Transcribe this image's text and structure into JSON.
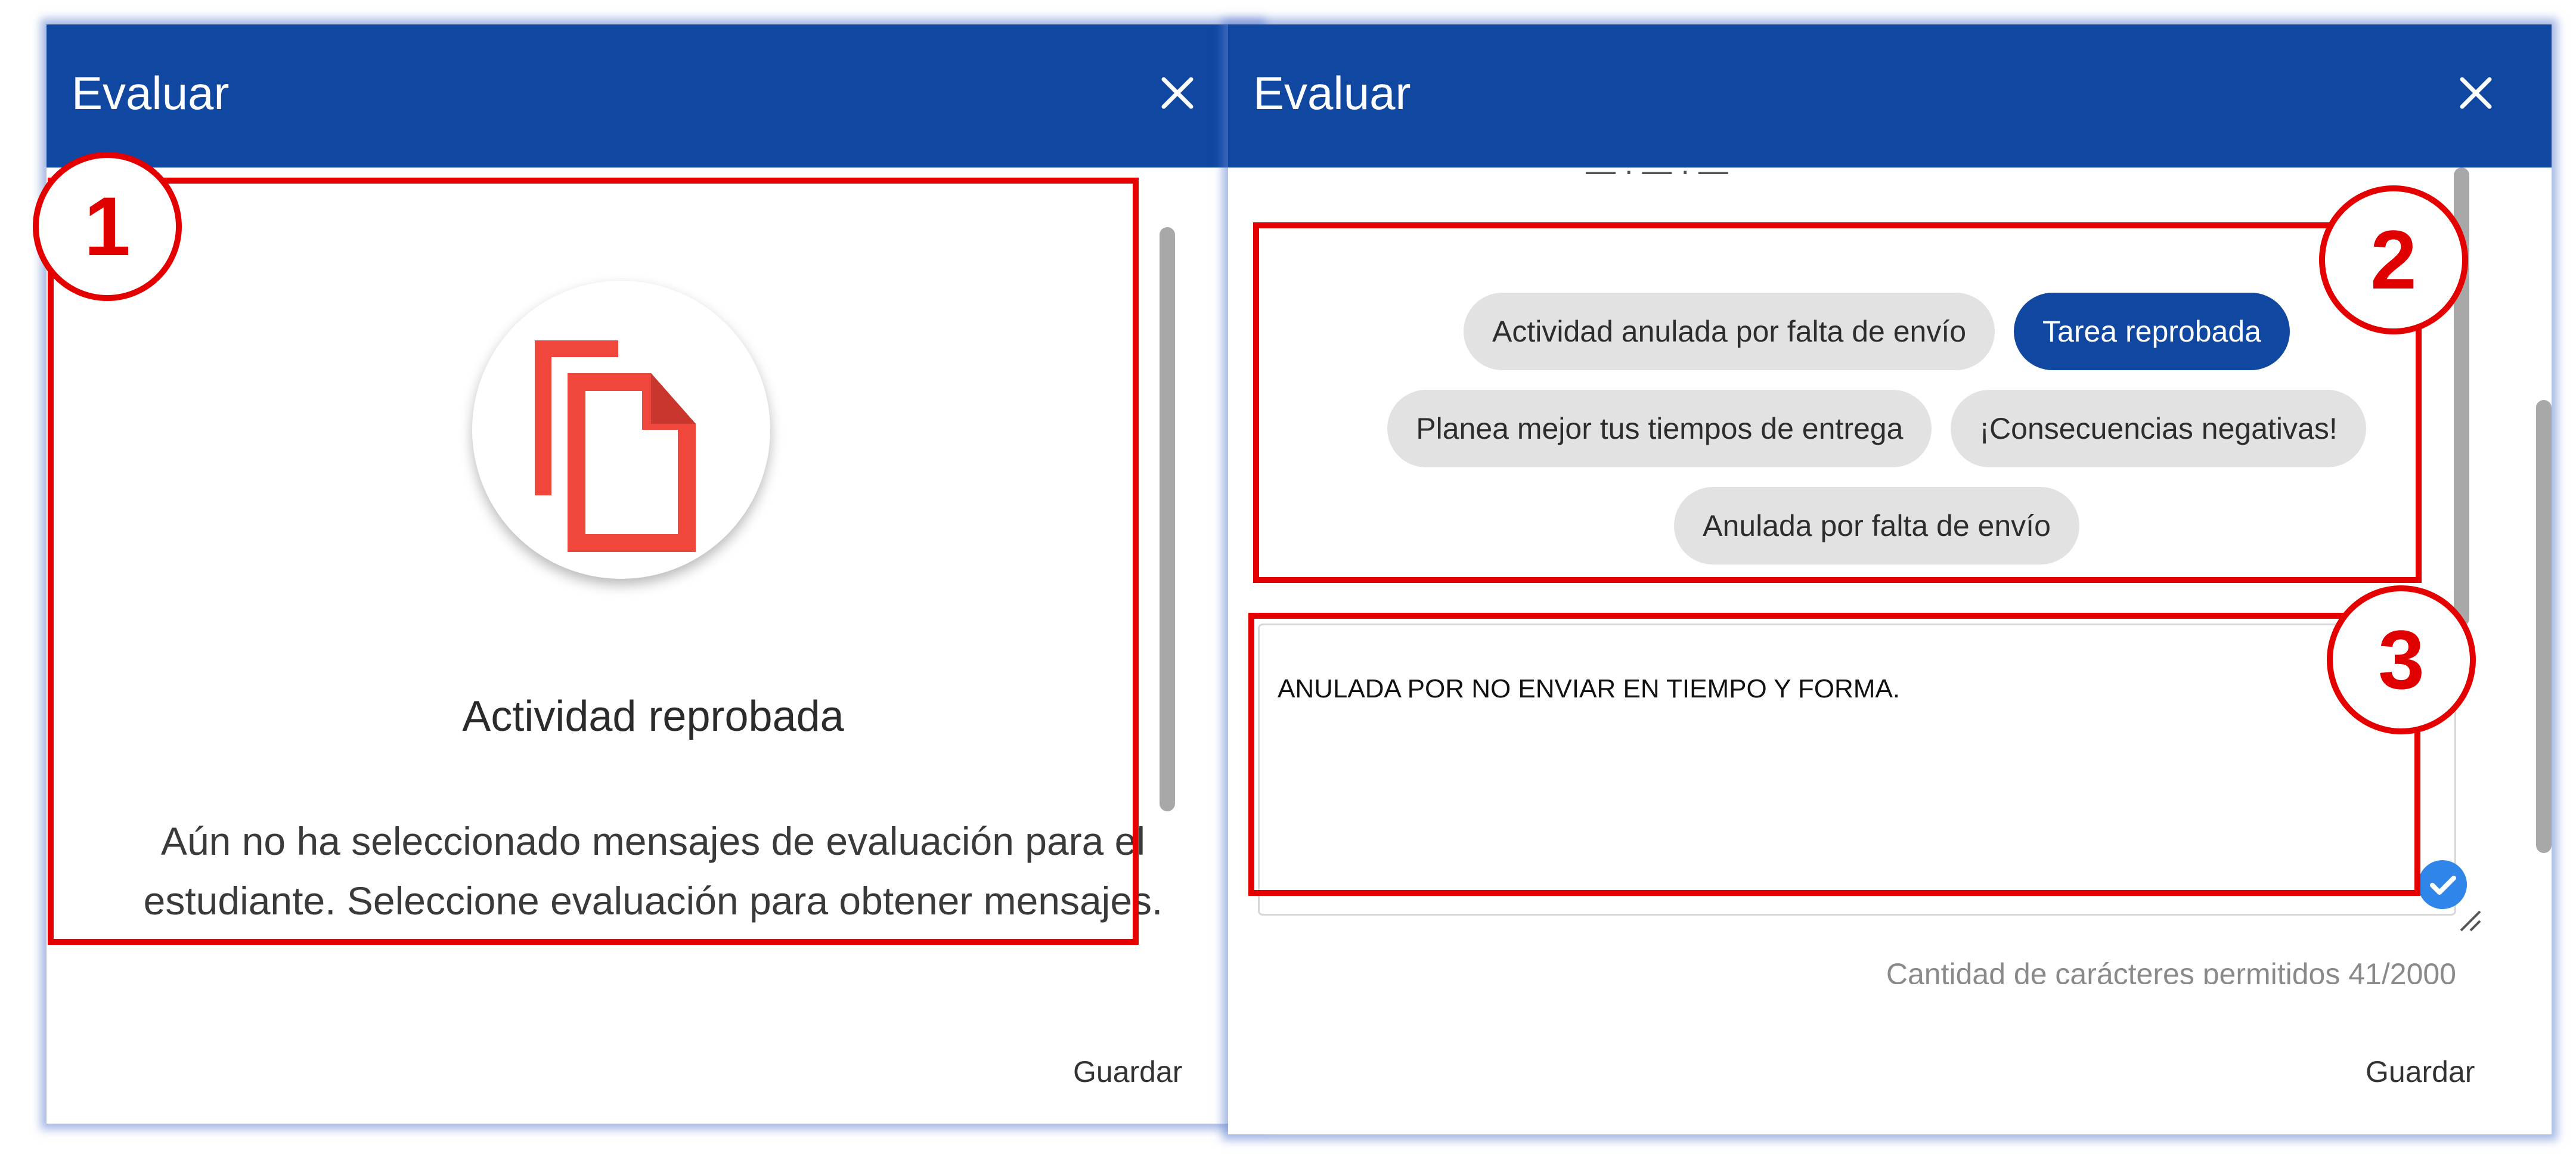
{
  "dialog_left": {
    "title": "Evaluar",
    "close_icon": "close-icon",
    "status_icon": "copy-document-icon",
    "heading": "Actividad reprobada",
    "message_line1": "Aún no ha seleccionado mensajes de evaluación para el",
    "message_line2": "estudiante. Seleccione evaluación para obtener mensajes.",
    "save_label": "Guardar"
  },
  "dialog_right": {
    "title": "Evaluar",
    "close_icon": "close-icon",
    "chips": [
      {
        "label": "Actividad anulada por falta de envío",
        "selected": false
      },
      {
        "label": "Tarea reprobada",
        "selected": true
      },
      {
        "label": "Planea mejor tus tiempos de entrega",
        "selected": false
      },
      {
        "label": "¡Consecuencias negativas!",
        "selected": false
      },
      {
        "label": "Anulada por falta de envío",
        "selected": false
      }
    ],
    "comment_text": "ANULADA POR NO ENVIAR EN TIEMPO Y FORMA.",
    "char_counter": "Cantidad de carácteres permitidos 41/2000",
    "save_label": "Guardar"
  },
  "annotations": {
    "one": "1",
    "two": "2",
    "three": "3"
  },
  "colors": {
    "header": "#0f47a1",
    "selected_chip": "#0f47a1",
    "annotation_red": "#e50000",
    "icon_red": "#f0463c"
  }
}
